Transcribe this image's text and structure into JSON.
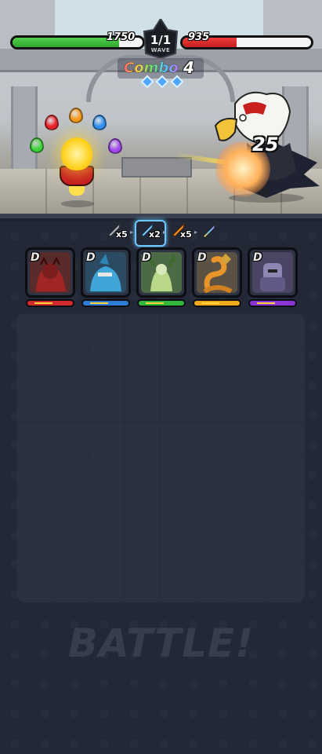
{
  "battle": {
    "player_hp": "1750",
    "player_hp_fraction": 0.82,
    "enemy_hp": "935",
    "enemy_hp_fraction": 0.42,
    "wave": "1/1",
    "wave_label": "WAVE",
    "combo_label": "Combo",
    "combo_count": "4",
    "combo_gems": 3,
    "damage_number": "25",
    "orb_colors": [
      "#e8222a",
      "#f59a1a",
      "#2f8ff0",
      "#3fd43a",
      "#a348f0"
    ]
  },
  "weapon_chain": [
    {
      "name": "grey-sword",
      "multiplier": "x5",
      "color": "#b9bec7"
    },
    {
      "name": "blue-sword",
      "multiplier": "x2",
      "color": "#7fd4ff",
      "selected": true
    },
    {
      "name": "orange-sword",
      "multiplier": "x5",
      "color": "#ff9a2a"
    },
    {
      "name": "rainbow-sword",
      "multiplier": "",
      "color": "#66c6ff"
    }
  ],
  "heroes": [
    {
      "name": "red-beast",
      "rank": "D",
      "bg": "#5a2b2b",
      "bar_color": "#d22a2a",
      "accent": "#a12525"
    },
    {
      "name": "blue-shark",
      "rank": "D",
      "bg": "#2b4b62",
      "bar_color": "#2f7cd6",
      "accent": "#3fa5d6"
    },
    {
      "name": "green-deer",
      "rank": "D",
      "bg": "#4c6a45",
      "bar_color": "#2fb83a",
      "accent": "#b9d88a"
    },
    {
      "name": "orange-snake",
      "rank": "D",
      "bg": "#5b5244",
      "bar_color": "#f1a91c",
      "accent": "#e8962a"
    },
    {
      "name": "purple-knight",
      "rank": "D",
      "bg": "#4a4563",
      "bar_color": "#8b35d6",
      "accent": "#8c87b3"
    }
  ],
  "battle_button": "BATTLE!"
}
